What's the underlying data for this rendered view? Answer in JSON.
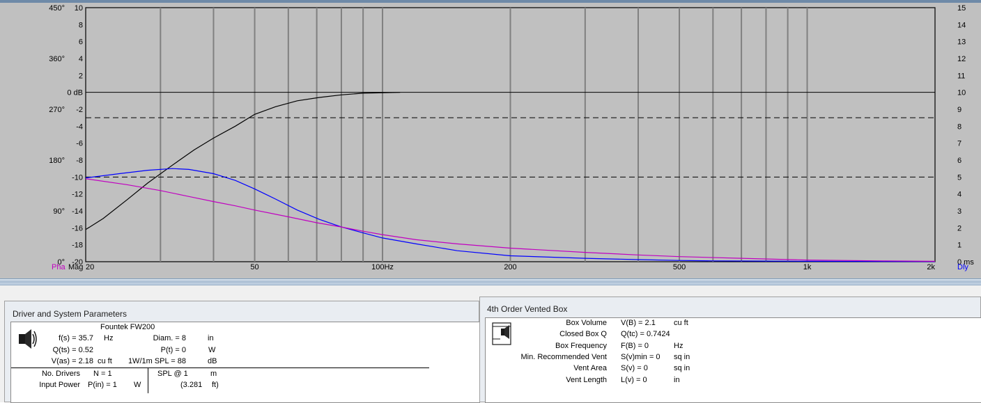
{
  "chart_data": {
    "type": "line",
    "x_scale": "log",
    "xlim": [
      20,
      2000
    ],
    "x_ticks": [
      "20",
      "50",
      "100Hz",
      "200",
      "500",
      "1k",
      "2k"
    ],
    "ylim": [
      -20,
      10
    ],
    "left_mag_ticks": [
      "10",
      "8",
      "6",
      "4",
      "2",
      "0 dB",
      "-2",
      "-4",
      "-6",
      "-8",
      "-10",
      "-12",
      "-14",
      "-16",
      "-18",
      "-20"
    ],
    "left_phase_ticks": [
      "450°",
      "360°",
      "270°",
      "180°",
      "90°",
      "0°"
    ],
    "right_delay_ticks": [
      "15",
      "14",
      "13",
      "12",
      "11",
      "10",
      "9",
      "8",
      "7",
      "6",
      "5",
      "4",
      "3",
      "2",
      "1",
      "0 ms"
    ],
    "left_labels": {
      "phase": "Pha",
      "magnitude": "Mag"
    },
    "right_label": "Dly",
    "grid": true,
    "reference_lines": [
      {
        "style": "solid",
        "y": 0
      },
      {
        "style": "dashed",
        "y": -3
      },
      {
        "style": "dashed",
        "y": -10
      }
    ],
    "series": [
      {
        "color": "#000000",
        "x": [
          20,
          22,
          25,
          28,
          32,
          36,
          40,
          45,
          50,
          56,
          63,
          71,
          80,
          90,
          100,
          110
        ],
        "y": [
          -16.2,
          -14.9,
          -12.7,
          -10.7,
          -8.6,
          -6.8,
          -5.4,
          -4.0,
          -2.6,
          -1.7,
          -1.0,
          -0.6,
          -0.3,
          -0.1,
          -0.05,
          0.0
        ]
      },
      {
        "color": "#0000ff",
        "x": [
          20,
          24,
          28,
          32,
          35,
          40,
          45,
          50,
          56,
          63,
          71,
          80,
          90,
          100,
          120,
          150,
          200,
          300,
          400,
          500,
          600,
          800,
          1000,
          1500,
          2000
        ],
        "y": [
          -10.1,
          -9.6,
          -9.2,
          -9.0,
          -9.1,
          -9.6,
          -10.4,
          -11.4,
          -12.6,
          -13.9,
          -15.0,
          -15.9,
          -16.6,
          -17.2,
          -17.9,
          -18.7,
          -19.3,
          -19.6,
          -19.75,
          -19.85,
          -19.9,
          -19.93,
          -19.95,
          -19.97,
          -19.98
        ]
      },
      {
        "color": "#c000c0",
        "x": [
          20,
          25,
          30,
          35,
          40,
          45,
          50,
          60,
          70,
          80,
          90,
          100,
          120,
          150,
          200,
          300,
          400,
          500,
          700,
          1000,
          1500,
          2000
        ],
        "y": [
          -10.2,
          -10.9,
          -11.6,
          -12.3,
          -12.9,
          -13.4,
          -13.9,
          -14.7,
          -15.4,
          -15.9,
          -16.4,
          -16.8,
          -17.4,
          -17.9,
          -18.4,
          -18.9,
          -19.2,
          -19.4,
          -19.6,
          -19.8,
          -19.9,
          -19.95
        ]
      }
    ]
  },
  "left_panel": {
    "title": "Driver and System Parameters",
    "driver_name": "Fountek FW200",
    "fs_label": "f(s) = 35.7",
    "fs_unit": "Hz",
    "qts_label": "Q(ts) = 0.52",
    "vas_label": "V(as) = 2.18",
    "vas_unit": "cu ft",
    "diam_label": "Diam. = 8",
    "diam_unit": "in",
    "pt_label": "P(t) = 0",
    "pt_unit": "W",
    "spl_label": "1W/1m SPL = 88",
    "spl_unit": "dB",
    "drivers_label": "No. Drivers",
    "drivers_value": "N = 1",
    "power_label": "Input Power",
    "power_value": "P(in) = 1",
    "power_unit": "W",
    "splat_label": "SPL @ 1",
    "splat_unit": "m",
    "splat_ft": "(3.281",
    "splat_ft_unit": "ft)"
  },
  "right_panel": {
    "title": "4th Order Vented Box",
    "rows": [
      {
        "label": "Box Volume",
        "value": "V(B) = 2.1",
        "unit": "cu ft"
      },
      {
        "label": "Closed Box Q",
        "value": "Q(tc) = 0.7424",
        "unit": ""
      },
      {
        "label": "Box Frequency",
        "value": "F(B) = 0",
        "unit": "Hz"
      },
      {
        "label": "Min. Recommended Vent",
        "value": "S(v)min = 0",
        "unit": "sq in"
      },
      {
        "label": "Vent Area",
        "value": "S(v) = 0",
        "unit": "sq in"
      },
      {
        "label": "Vent Length",
        "value": "L(v) = 0",
        "unit": "in"
      }
    ]
  }
}
